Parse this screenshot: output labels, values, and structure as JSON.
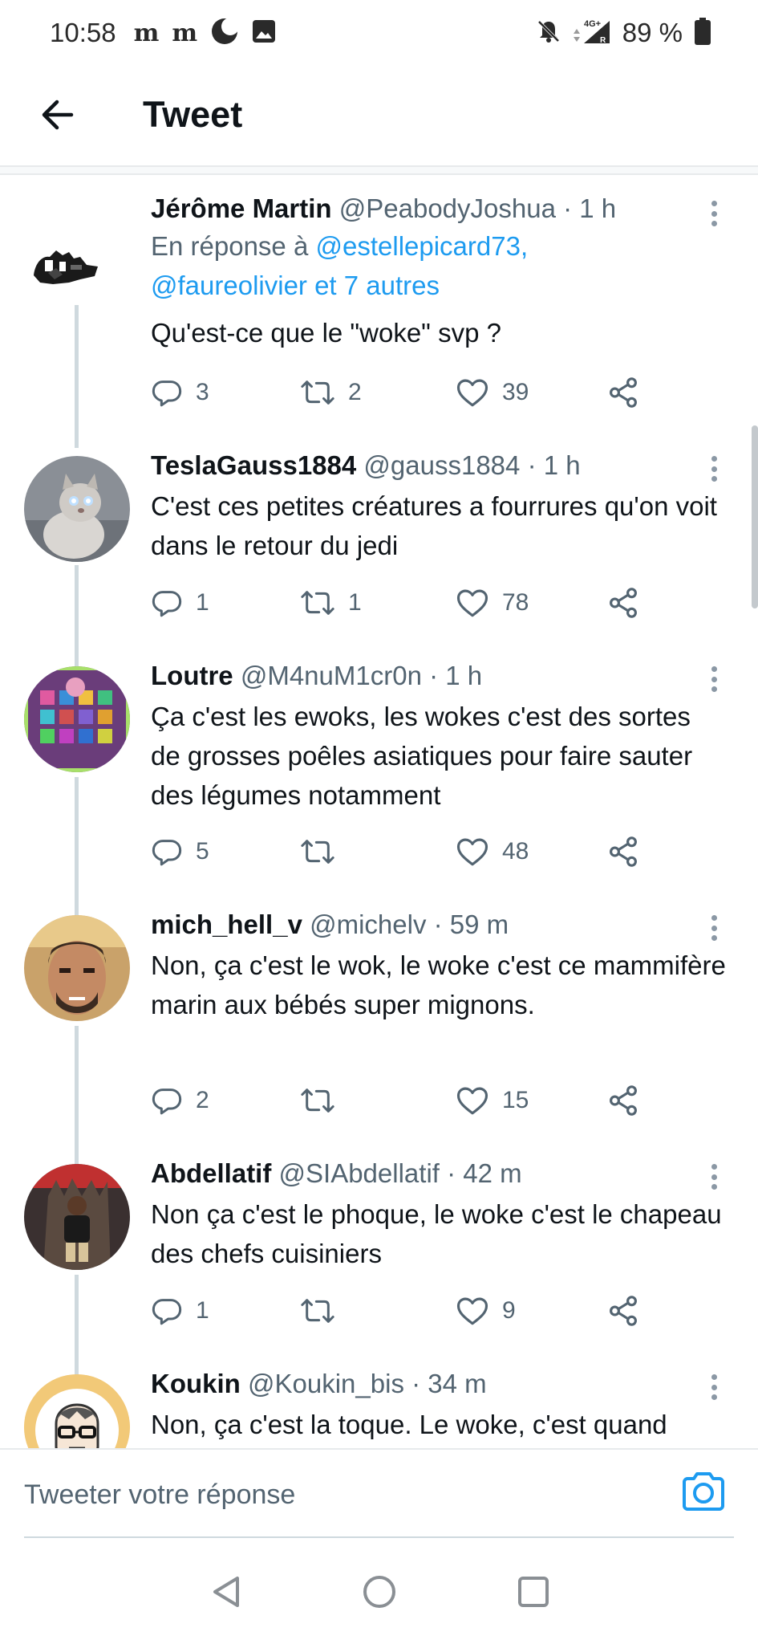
{
  "status_bar": {
    "time": "10:58",
    "left_icons": [
      "newspaper-m-icon",
      "newspaper-m-icon",
      "moon-icon",
      "image-icon"
    ],
    "network": "4G+",
    "battery": "89 %",
    "m_glyph": "m"
  },
  "header": {
    "title": "Tweet",
    "back_icon": "arrow-left-icon"
  },
  "tweets": [
    {
      "name": "Jérôme Martin",
      "handle": "@PeabodyJoshua",
      "time": "· 1 h",
      "reply_prefix": "En réponse à",
      "reply_mention_1": "@estellepicard73,",
      "reply_mention_2": "@faureolivier et 7 autres",
      "text": "Qu'est-ce que le \"woke\" svp ?",
      "replies": "3",
      "retweets": "2",
      "likes": "39"
    },
    {
      "name": "TeslaGauss1884",
      "handle": "@gauss1884",
      "time": "· 1 h",
      "text": "C'est ces petites créatures a fourrures qu'on voit dans le retour du jedi",
      "replies": "1",
      "retweets": "1",
      "likes": "78"
    },
    {
      "name": "Loutre",
      "handle": "@M4nuM1cr0n",
      "time": "· 1 h",
      "text": "Ça c'est les ewoks, les wokes c'est des sortes de grosses poêles asiatiques pour faire sauter des légumes notamment",
      "replies": "5",
      "retweets": "",
      "likes": "48"
    },
    {
      "name": "mich_hell_v",
      "handle": "@michelv",
      "time": "· 59 m",
      "text": "Non, ça c'est le wok, le woke c'est ce mammifère marin aux bébés super mignons.",
      "replies": "2",
      "retweets": "",
      "likes": "15"
    },
    {
      "name": "Abdellatif",
      "handle": "@SIAbdellatif",
      "time": "· 42 m",
      "text": "Non ça c'est le phoque, le woke c'est le chapeau des chefs cuisiniers",
      "replies": "1",
      "retweets": "",
      "likes": "9"
    },
    {
      "name": "Koukin",
      "handle": "@Koukin_bis",
      "time": "· 34 m",
      "text": "Non, ça c'est la toque. Le woke, c'est quand"
    }
  ],
  "composer": {
    "placeholder": "Tweeter votre réponse",
    "camera_icon": "camera-icon"
  },
  "navbar": {
    "icons": [
      "nav-back-triangle-icon",
      "nav-home-circle-icon",
      "nav-recents-square-icon"
    ]
  },
  "colors": {
    "accent": "#1d9bf0",
    "text_primary": "#0f1419",
    "text_secondary": "#536471",
    "thread_line": "#cfd9de"
  }
}
